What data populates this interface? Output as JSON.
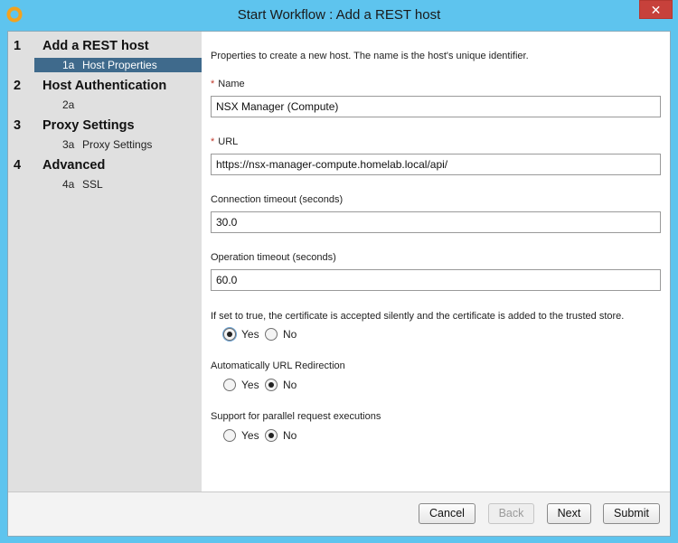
{
  "window": {
    "title": "Start Workflow : Add a REST host",
    "close_glyph": "✕",
    "app_icon": "vro-logo-icon"
  },
  "sidebar": {
    "steps": [
      {
        "number": "1",
        "label": "Add a REST host",
        "substeps": [
          {
            "id": "1a",
            "label": "Host Properties",
            "active": true
          }
        ]
      },
      {
        "number": "2",
        "label": "Host Authentication",
        "substeps": [
          {
            "id": "2a",
            "label": ""
          }
        ]
      },
      {
        "number": "3",
        "label": "Proxy Settings",
        "substeps": [
          {
            "id": "3a",
            "label": "Proxy Settings"
          }
        ]
      },
      {
        "number": "4",
        "label": "Advanced",
        "substeps": [
          {
            "id": "4a",
            "label": "SSL"
          }
        ]
      }
    ]
  },
  "form": {
    "intro": "Properties  to create a new host. The name is the host's unique identifier.",
    "required_marker": "*",
    "name": {
      "label": "Name",
      "value": "NSX Manager (Compute)"
    },
    "url": {
      "label": "URL",
      "value": "https://nsx-manager-compute.homelab.local/api/"
    },
    "connection_timeout": {
      "label": "Connection timeout (seconds)",
      "value": "30.0"
    },
    "operation_timeout": {
      "label": "Operation timeout (seconds)",
      "value": "60.0"
    },
    "accept_cert": {
      "label": "If set to true, the certificate is accepted silently and the certificate is added to the trusted store.",
      "yes": "Yes",
      "no": "No",
      "selected": "Yes"
    },
    "url_redirection": {
      "label": "Automatically URL Redirection",
      "yes": "Yes",
      "no": "No",
      "selected": "No"
    },
    "parallel_requests": {
      "label": "Support for parallel request executions",
      "yes": "Yes",
      "no": "No",
      "selected": "No"
    }
  },
  "footer": {
    "cancel": "Cancel",
    "back": "Back",
    "next": "Next",
    "submit": "Submit"
  },
  "colors": {
    "titlebar": "#5ec4ee",
    "active_step": "#3f6a8c",
    "close_button": "#c7413b",
    "required": "#c0392b"
  }
}
